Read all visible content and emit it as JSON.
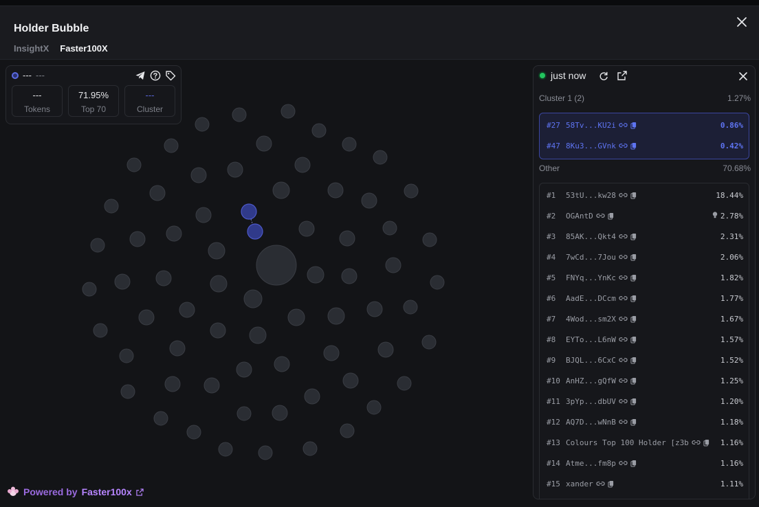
{
  "header": {
    "title": "Holder Bubble",
    "tabs": [
      {
        "label": "InsightX"
      },
      {
        "label": "Faster100X"
      }
    ],
    "close_icon": "close-icon"
  },
  "stat_card": {
    "name": "---",
    "sub": "---",
    "boxes": [
      {
        "value": "---",
        "label": "Tokens"
      },
      {
        "value": "71.95%",
        "label": "Top 70"
      },
      {
        "value": "---",
        "label": "Cluster"
      }
    ],
    "icons": [
      "telegram-icon",
      "help-icon",
      "tag-icon"
    ]
  },
  "powered": {
    "prefix": "Powered by",
    "brand": "Faster100x"
  },
  "panel": {
    "status": "just now",
    "cluster": {
      "title": "Cluster 1 (2)",
      "pct": "1.27%",
      "rows": [
        {
          "rank": "#27",
          "addr": "58Tv...KU2i",
          "pct": "0.86%"
        },
        {
          "rank": "#47",
          "addr": "8Ku3...GVnk",
          "pct": "0.42%"
        }
      ]
    },
    "other": {
      "title": "Other",
      "pct": "70.68%",
      "rows": [
        {
          "rank": "#1",
          "addr": "53tU...kw28",
          "pct": "18.44%"
        },
        {
          "rank": "#2",
          "addr": "OGAntD",
          "pct": "2.78%"
        },
        {
          "rank": "#3",
          "addr": "85AK...Qkt4",
          "pct": "2.31%"
        },
        {
          "rank": "#4",
          "addr": "7wCd...7Jou",
          "pct": "2.06%"
        },
        {
          "rank": "#5",
          "addr": "FNYq...YnKc",
          "pct": "1.82%"
        },
        {
          "rank": "#6",
          "addr": "AadE...DCcm",
          "pct": "1.77%"
        },
        {
          "rank": "#7",
          "addr": "4Wod...sm2X",
          "pct": "1.67%"
        },
        {
          "rank": "#8",
          "addr": "EYTo...L6nW",
          "pct": "1.57%"
        },
        {
          "rank": "#9",
          "addr": "BJQL...6CxC",
          "pct": "1.52%"
        },
        {
          "rank": "#10",
          "addr": "AnHZ...gQfW",
          "pct": "1.25%"
        },
        {
          "rank": "#11",
          "addr": "3pYp...dbUV",
          "pct": "1.20%"
        },
        {
          "rank": "#12",
          "addr": "AQ7D...wNnB",
          "pct": "1.18%"
        },
        {
          "rank": "#13",
          "addr": "Colours Top 100 Holder [z3b",
          "pct": "1.16%"
        },
        {
          "rank": "#14",
          "addr": "Atme...fm8p",
          "pct": "1.16%"
        },
        {
          "rank": "#15",
          "addr": "xander",
          "pct": "1.11%"
        }
      ]
    }
  },
  "colors": {
    "accent": "#5e74f2",
    "live": "#22c55e",
    "brand": "#b785ff",
    "bubble": "#2a2d33"
  }
}
